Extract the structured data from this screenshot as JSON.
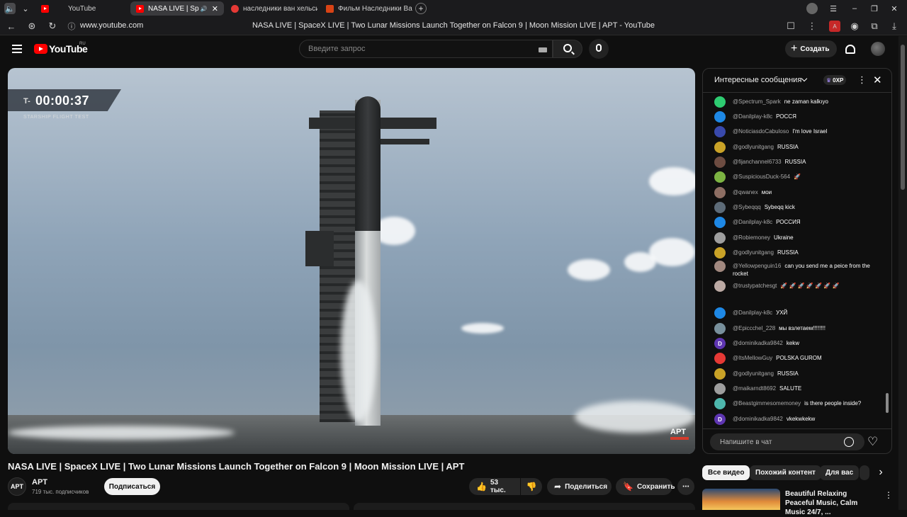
{
  "browser": {
    "tabs": [
      {
        "label": ""
      },
      {
        "label": "YouTube"
      },
      {
        "label": "NASA LIVE | SpaceX"
      },
      {
        "label": "наследники ван хельсинг"
      },
      {
        "label": "Фильм Наследники Ван Х"
      }
    ],
    "url": "www.youtube.com",
    "page_title": "NASA LIVE | SpaceX LIVE | Two Lunar Missions Launch Together on Falcon 9 | Moon Mission LIVE | APT - YouTube"
  },
  "header": {
    "logo_text": "YouTube",
    "region": "RU",
    "search_placeholder": "Введите запрос",
    "create_label": "Создать"
  },
  "player": {
    "timer_prefix": "T-",
    "timer": "00:00:37",
    "flight_label": "STARSHIP FLIGHT TEST",
    "watermark": "APT"
  },
  "video": {
    "title": "NASA LIVE | SpaceX LIVE | Two Lunar Missions Launch Together on Falcon 9 | Moon Mission LIVE | APT",
    "channel_avatar": "APT",
    "channel_name": "APT",
    "subscribers": "719 тыс. подписчиков",
    "subscribe_label": "Подписаться",
    "likes": "53 тыс.",
    "share_label": "Поделиться",
    "save_label": "Сохранить"
  },
  "chat": {
    "title": "Интересные сообщения",
    "xp": "0XP",
    "input_placeholder": "Напишите в чат",
    "messages": [
      {
        "author": "@Spectrum_Spark",
        "text": "ne zaman kalkıyo",
        "color": "#2ecc71"
      },
      {
        "author": "@Danilplay-k8c",
        "text": "РОССЯ",
        "color": "#1e88e5"
      },
      {
        "author": "@NoticiasdoCabuloso",
        "text": "I'm love Israel",
        "color": "#3949ab"
      },
      {
        "author": "@godlyunitgang",
        "text": "RUSSIA",
        "color": "#c9a227"
      },
      {
        "author": "@fijanchannel6733",
        "text": "RUSSIA",
        "color": "#6d4c41"
      },
      {
        "author": "@SuspiciousDuck-564",
        "text": "🚀",
        "color": "#7cb342"
      },
      {
        "author": "@qwanex",
        "text": "мои",
        "color": "#8d6e63"
      },
      {
        "author": "@Sybeqqq",
        "text": "Sybeqq kick",
        "color": "#5d6b78"
      },
      {
        "author": "@Danilplay-k8c",
        "text": "РОССИЯ",
        "color": "#1e88e5"
      },
      {
        "author": "@Robiemoney",
        "text": "Ukraine",
        "color": "#9e9e9e"
      },
      {
        "author": "@godlyunitgang",
        "text": "RUSSIA",
        "color": "#c9a227"
      },
      {
        "author": "@Yellowpenguin16",
        "text": "can you send me a peice from the rocket",
        "color": "#a1887f"
      },
      {
        "author": "@trustypatchesgt",
        "text": "🚀 🚀 🚀 🚀 🚀 🚀 🚀",
        "color": "#bcaaa4"
      },
      {
        "author": "@Danilplay-k8c",
        "text": "УХЙ",
        "color": "#1e88e5"
      },
      {
        "author": "@Epiccchel_228",
        "text": "мы взлетаем!!!!!!!!",
        "color": "#78909c"
      },
      {
        "author": "@dominikadka9842",
        "text": "kekw",
        "color": "#5e35b1",
        "initial": "D"
      },
      {
        "author": "@ItsMellowGuy",
        "text": "POLSKA GUROM",
        "color": "#e53935"
      },
      {
        "author": "@godlyunitgang",
        "text": "RUSSIA",
        "color": "#c9a227"
      },
      {
        "author": "@maikarndt8692",
        "text": "SALUTE",
        "color": "#9e9e9e"
      },
      {
        "author": "@Beastgimmesomemoney",
        "text": "is there people inside?",
        "color": "#4db6ac"
      },
      {
        "author": "@dominikadka9842",
        "text": "vkekwkekw",
        "color": "#5e35b1",
        "initial": "D"
      }
    ]
  },
  "recommendations": {
    "chips": [
      "Все видео",
      "Похожий контент",
      "Для вас"
    ],
    "first_title": "Beautiful Relaxing Peaceful Music, Calm Music 24/7, ..."
  }
}
